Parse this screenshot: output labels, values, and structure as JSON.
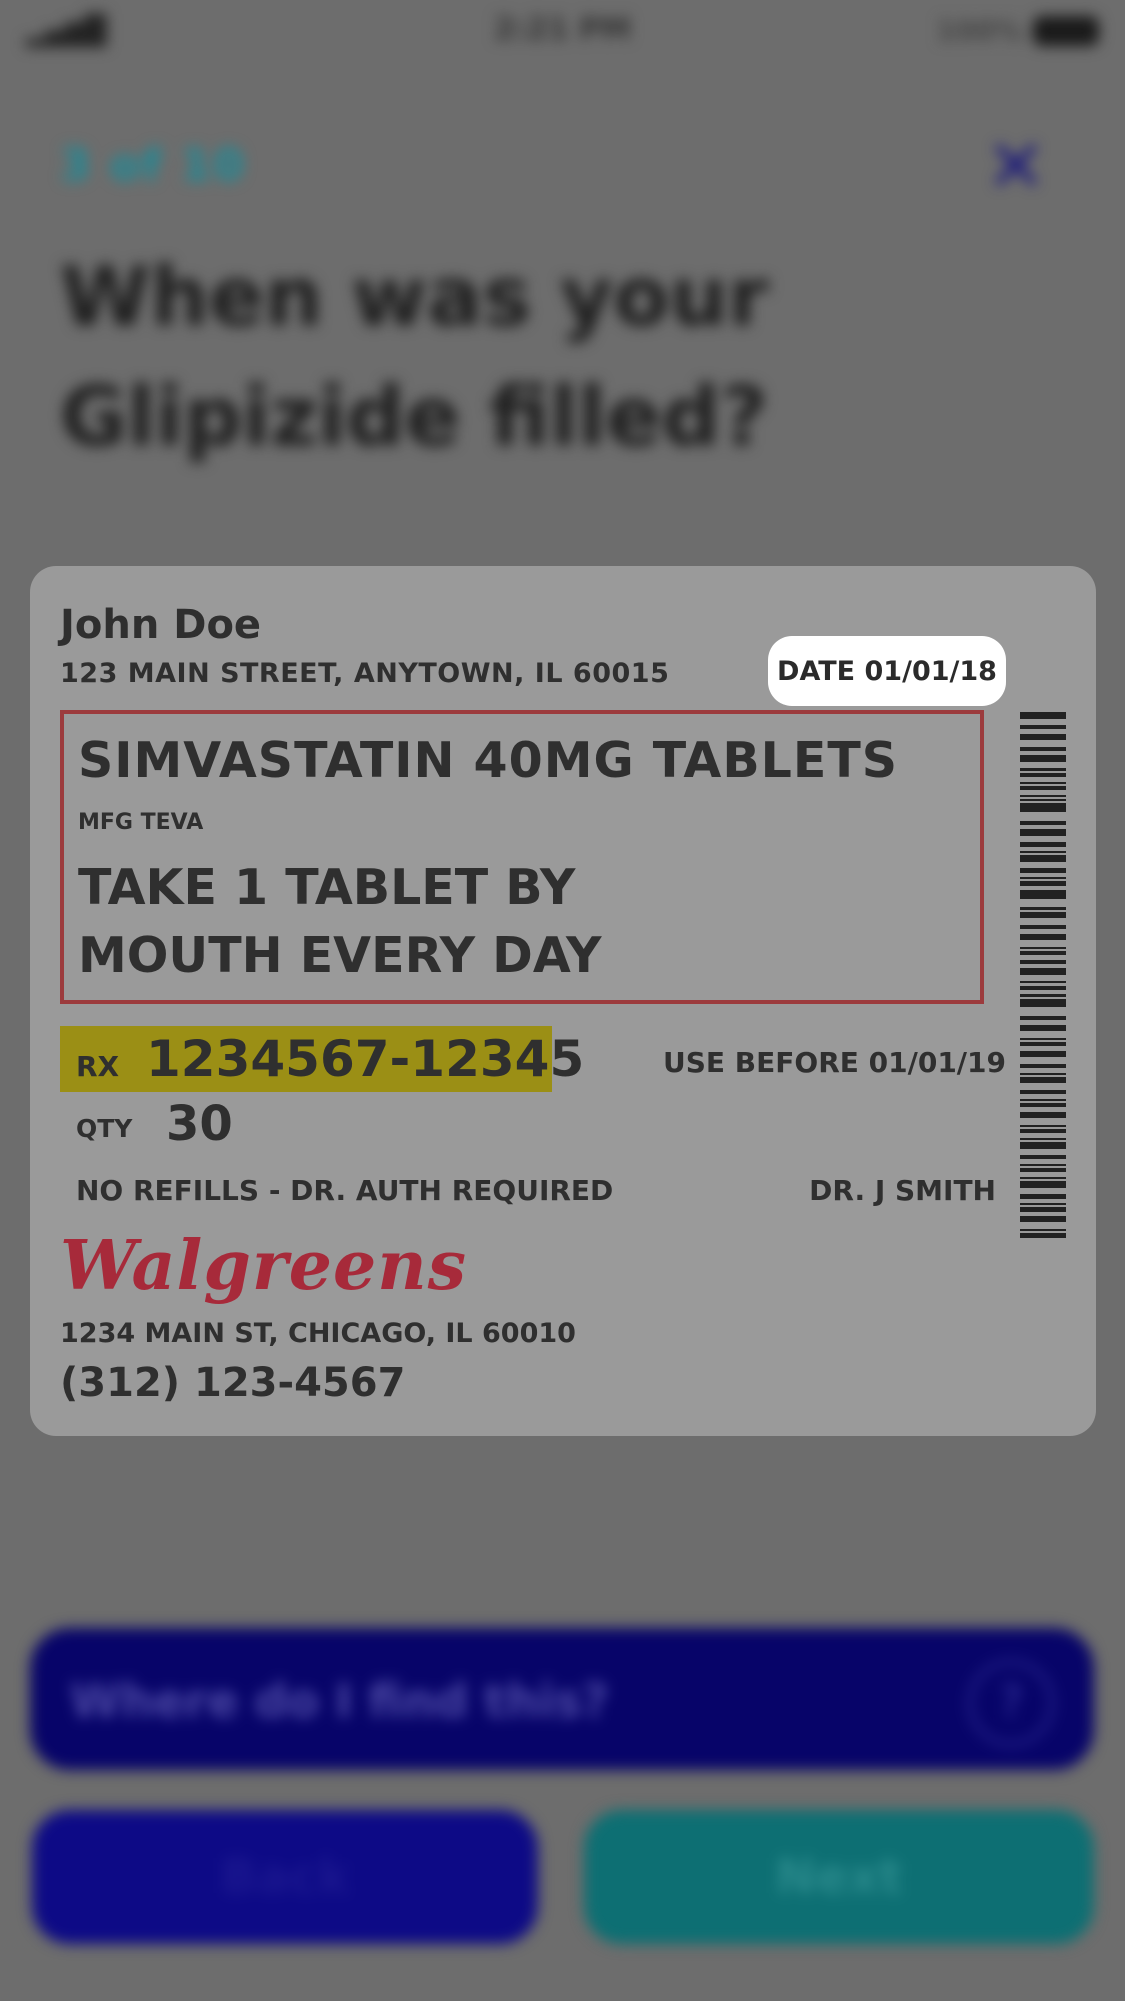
{
  "status_bar": {
    "signal_icon": "signal-icon",
    "time": "2:21 PM",
    "battery_percent": "100%",
    "battery_icon": "battery-icon"
  },
  "header": {
    "step_label": "3 of 10",
    "close_icon": "close-icon",
    "question": "When was your Glipizide filled?"
  },
  "label": {
    "patient_name": "John Doe",
    "patient_address": "123 MAIN STREET, ANYTOWN, IL 60015",
    "date": "DATE 01/01/18",
    "drug_name": "SIMVASTATIN 40MG TABLETS",
    "manufacturer": "MFG TEVA",
    "directions": "TAKE 1 TABLET BY MOUTH EVERY DAY",
    "rx_label": "RX",
    "rx_number": "1234567-12345",
    "use_before": "USE BEFORE 01/01/19",
    "qty_label": "QTY",
    "qty_value": "30",
    "refills": "NO REFILLS - DR. AUTH REQUIRED",
    "doctor": "DR. J SMITH",
    "pharmacy_name": "Walgreens",
    "pharmacy_address": "1234 MAIN ST, CHICAGO, IL 60010",
    "pharmacy_phone": "(312) 123-4567",
    "colors": {
      "highlight_rx": "#9b8f15",
      "drug_box_border": "#9c3b3d",
      "date_pill": "#ffffff",
      "pharmacy_logo": "#a72a3a"
    }
  },
  "help": {
    "text": "Where do I find this?",
    "icon": "help-icon"
  },
  "buttons": {
    "back": "Back",
    "next": "Next"
  }
}
